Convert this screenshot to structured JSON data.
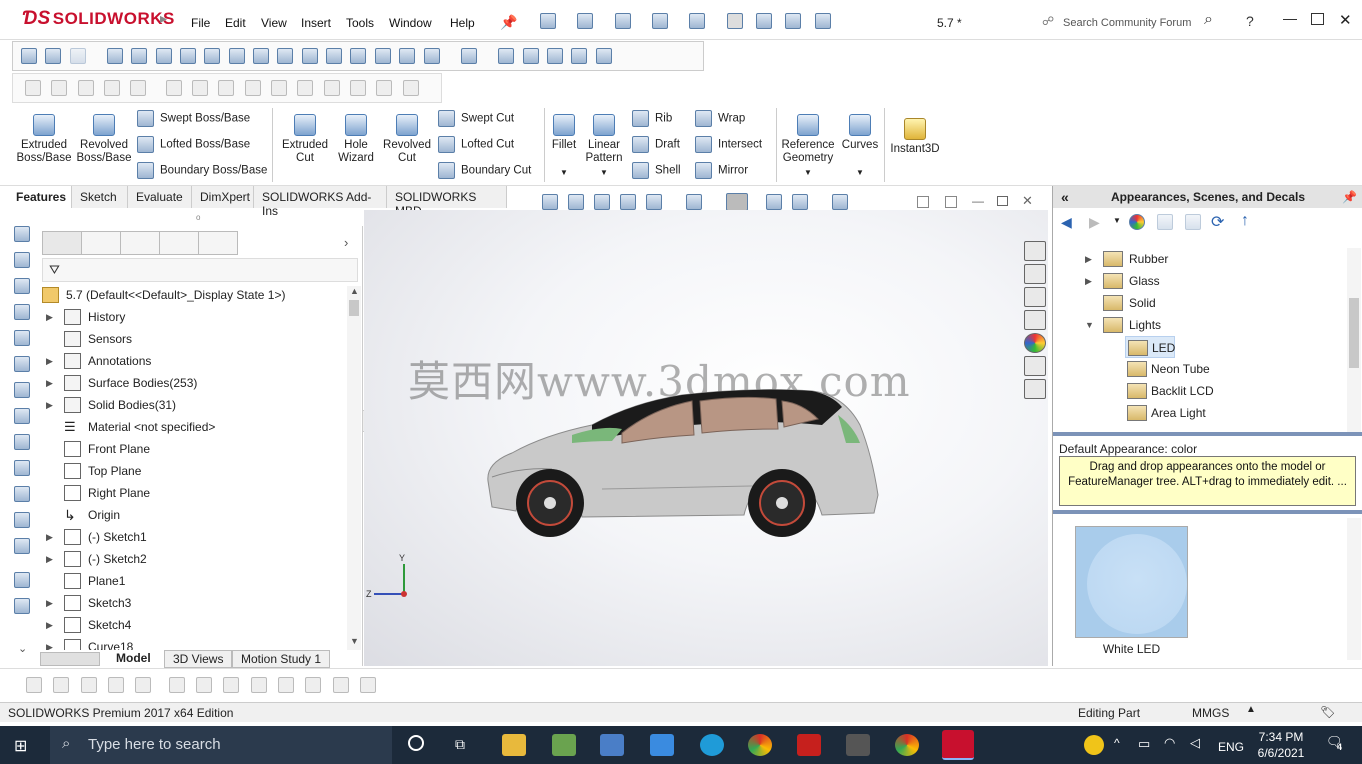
{
  "app": {
    "brand": "SOLIDWORKS",
    "doc_title": "5.7 *"
  },
  "menu": [
    "File",
    "Edit",
    "View",
    "Insert",
    "Tools",
    "Window",
    "Help"
  ],
  "search": {
    "placeholder": "Search Community Forum"
  },
  "ribbon": {
    "extruded_boss": "Extruded\nBoss/Base",
    "revolved_boss": "Revolved\nBoss/Base",
    "swept_boss": "Swept Boss/Base",
    "lofted_boss": "Lofted Boss/Base",
    "boundary_boss": "Boundary Boss/Base",
    "extruded_cut": "Extruded\nCut",
    "hole_wizard": "Hole\nWizard",
    "revolved_cut": "Revolved\nCut",
    "swept_cut": "Swept Cut",
    "lofted_cut": "Lofted Cut",
    "boundary_cut": "Boundary Cut",
    "fillet": "Fillet",
    "linear_pattern": "Linear\nPattern",
    "rib": "Rib",
    "draft": "Draft",
    "shell": "Shell",
    "wrap": "Wrap",
    "intersect": "Intersect",
    "mirror": "Mirror",
    "reference_geometry": "Reference\nGeometry",
    "curves": "Curves",
    "instant3d": "Instant3D"
  },
  "cm_tabs": [
    "Features",
    "Sketch",
    "Evaluate",
    "DimXpert",
    "SOLIDWORKS Add-Ins",
    "SOLIDWORKS MBD"
  ],
  "tree": {
    "root": "5.7  (Default<<Default>_Display State 1>)",
    "items": [
      "History",
      "Sensors",
      "Annotations",
      "Surface Bodies(253)",
      "Solid Bodies(31)",
      "Material <not specified>",
      "Front Plane",
      "Top Plane",
      "Right Plane",
      "Origin",
      "(-) Sketch1",
      "(-) Sketch2",
      "Plane1",
      "Sketch3",
      "Sketch4",
      "Curve18"
    ]
  },
  "bottom_tabs": [
    "Model",
    "3D Views",
    "Motion Study 1"
  ],
  "watermark": "莫西网www.3dmox.com",
  "triad": {
    "y": "Y",
    "z": "Z"
  },
  "right_panel": {
    "title": "Appearances, Scenes, and Decals",
    "folders": [
      "Rubber",
      "Glass",
      "Solid",
      "Lights"
    ],
    "lights": [
      "LED",
      "Neon Tube",
      "Backlit LCD",
      "Area Light"
    ],
    "default_appearance": "Default Appearance: color",
    "tip": "Drag and drop appearances onto the model or FeatureManager tree.  ALT+drag to immediately edit. ...",
    "thumb_label": "White LED"
  },
  "status": {
    "edition": "SOLIDWORKS Premium 2017 x64 Edition",
    "mode": "Editing Part",
    "units": "MMGS"
  },
  "taskbar": {
    "search": "Type here to search",
    "lang": "ENG",
    "time": "7:34 PM",
    "date": "6/6/2021",
    "notif": "4"
  }
}
